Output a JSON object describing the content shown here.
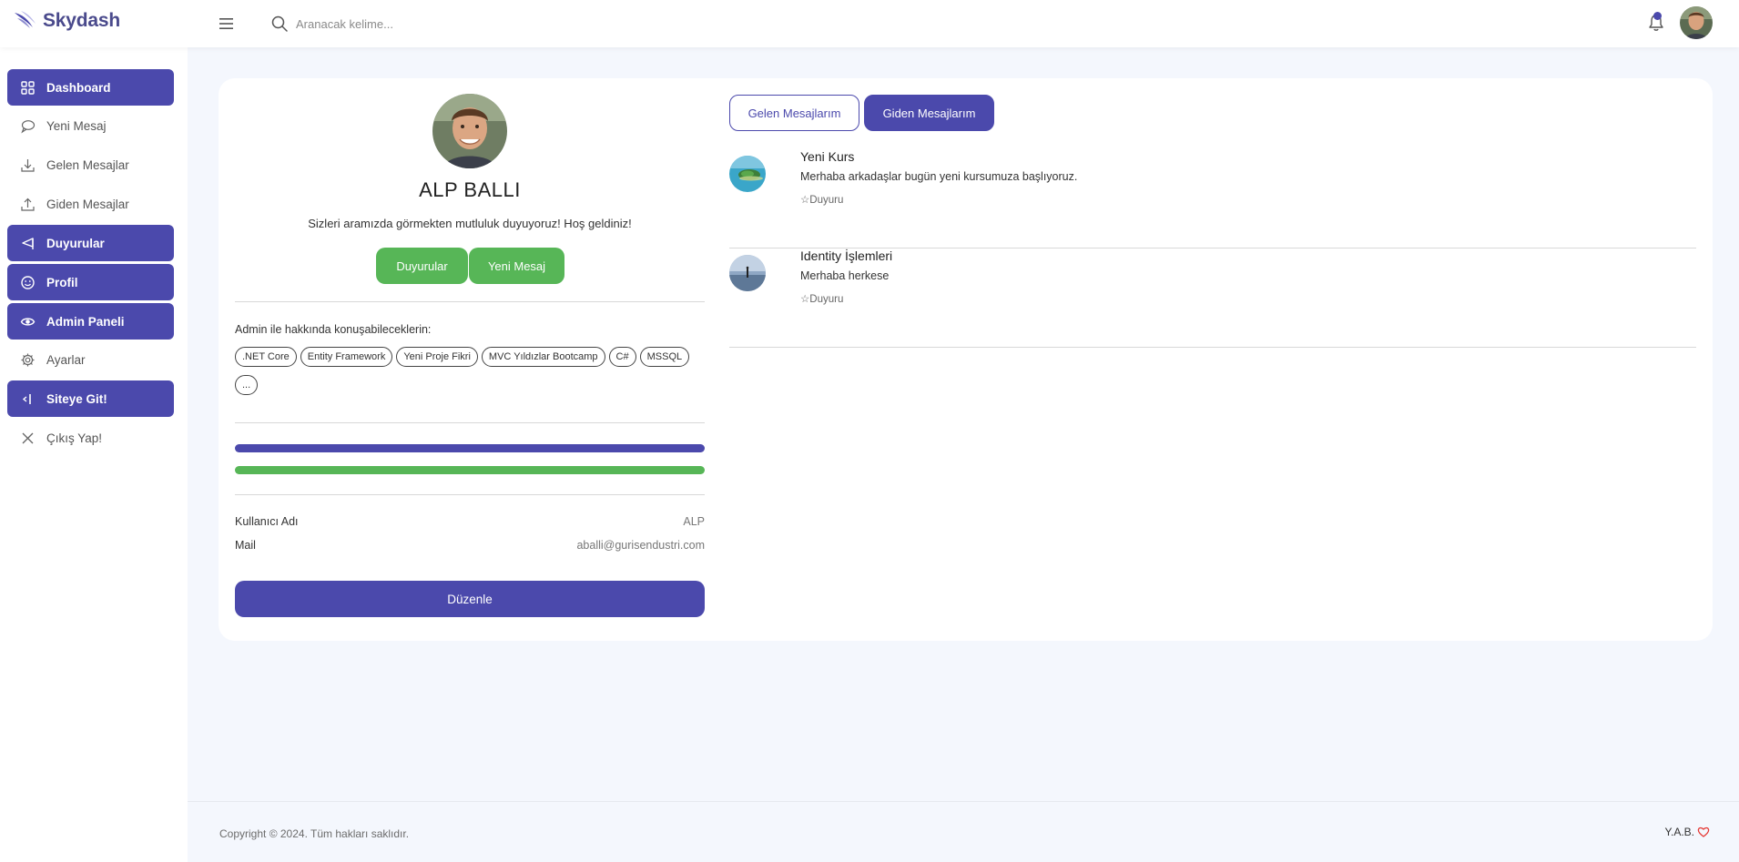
{
  "brand": {
    "name": "Skydash"
  },
  "search": {
    "placeholder": "Aranacak kelime..."
  },
  "sidebar": {
    "items": [
      {
        "label": "Dashboard",
        "icon": "grid-icon",
        "active": true
      },
      {
        "label": "Yeni Mesaj",
        "icon": "message-icon",
        "active": false
      },
      {
        "label": "Gelen Mesajlar",
        "icon": "download-icon",
        "active": false
      },
      {
        "label": "Giden Mesajlar",
        "icon": "upload-icon",
        "active": false
      },
      {
        "label": "Duyurular",
        "icon": "announcement-icon",
        "active": true
      },
      {
        "label": "Profil",
        "icon": "smile-icon",
        "active": true
      },
      {
        "label": "Admin Paneli",
        "icon": "eye-icon",
        "active": true
      },
      {
        "label": "Ayarlar",
        "icon": "gear-icon",
        "active": false
      },
      {
        "label": "Siteye Git!",
        "icon": "exit-arrow-icon",
        "active": true
      },
      {
        "label": "Çıkış Yap!",
        "icon": "close-icon",
        "active": false
      }
    ]
  },
  "profile": {
    "name": "ALP BALLI",
    "welcome": "Sizleri aramızda görmekten mutluluk duyuyoruz! Hoş geldiniz!",
    "buttons": {
      "announcements": "Duyurular",
      "new_message": "Yeni Mesaj"
    },
    "topics_label": "Admin ile hakkında konuşabileceklerin:",
    "tags": [
      ".NET Core",
      "Entity Framework",
      "Yeni Proje Fikri",
      "MVC Yıldızlar Bootcamp",
      "C#",
      "MSSQL",
      "..."
    ],
    "progress": [
      {
        "value": 100,
        "color": "#4b49ac"
      },
      {
        "value": 100,
        "color": "#57b657"
      }
    ],
    "info": [
      {
        "key": "Kullanıcı Adı",
        "value": "ALP"
      },
      {
        "key": "Mail",
        "value": "aballi@gurisendustri.com"
      }
    ],
    "edit_button": "Düzenle"
  },
  "messages": {
    "tabs": {
      "inbox": "Gelen Mesajlarım",
      "sent": "Giden Mesajlarım"
    },
    "active_tab": "sent",
    "items": [
      {
        "title": "Yeni Kurs",
        "body": "Merhaba arkadaşlar bugün yeni kursumuza başlıyoruz.",
        "tag": "☆Duyuru"
      },
      {
        "title": "Identity İşlemleri",
        "body": "Merhaba herkese",
        "tag": "☆Duyuru"
      }
    ]
  },
  "footer": {
    "copyright": "Copyright © 2024. Tüm hakları saklıdır.",
    "signature": "Y.A.B."
  },
  "colors": {
    "primary": "#4b49ac",
    "success": "#57b657",
    "background": "#f4f7fd",
    "heart": "#e53935"
  }
}
